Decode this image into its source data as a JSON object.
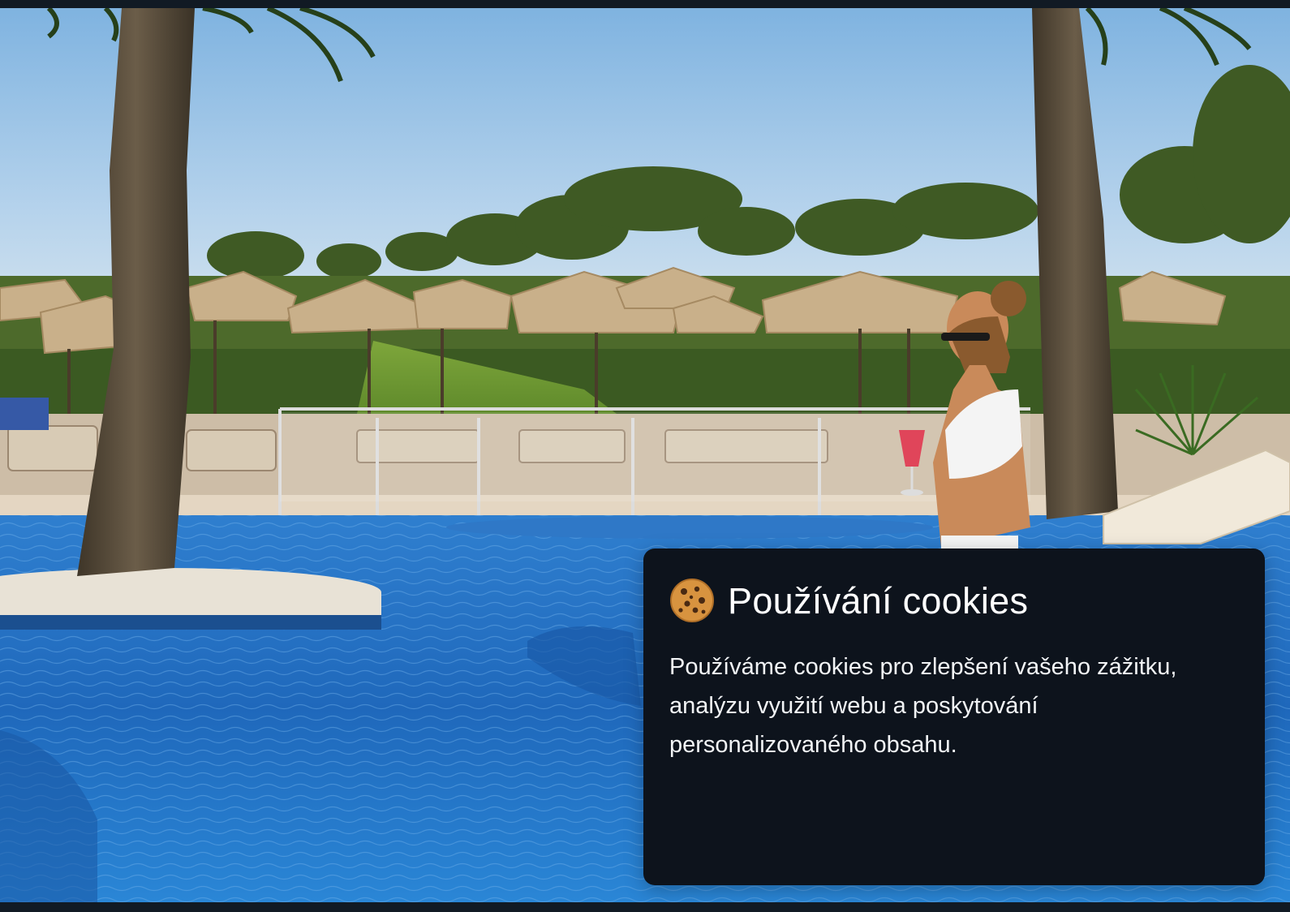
{
  "background": {
    "description_icon": "resort-pool-photo"
  },
  "cookie_banner": {
    "icon": "cookie-icon",
    "title": "Používání cookies",
    "text": "Používáme cookies pro zlepšení vašeho zážitku, analýzu využití webu a poskytování personalizovaného obsahu."
  },
  "colors": {
    "modal_bg": "#0d131c",
    "page_bg": "#0d141d",
    "text": "#ffffff"
  }
}
